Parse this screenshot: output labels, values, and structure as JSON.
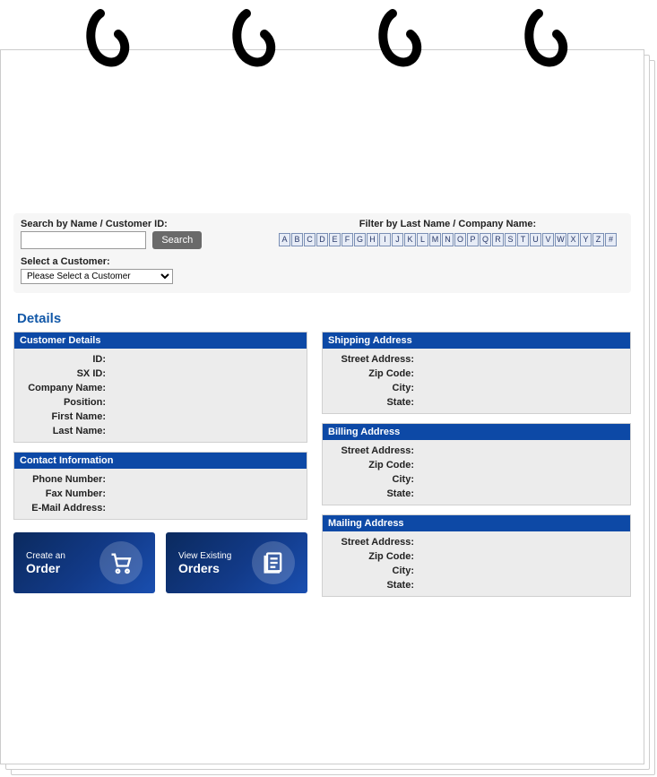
{
  "search": {
    "label": "Search by Name / Customer ID:",
    "button": "Search",
    "value": ""
  },
  "selectCustomer": {
    "label": "Select a Customer:",
    "placeholder": "Please Select a Customer"
  },
  "filter": {
    "label": "Filter by Last Name / Company Name:",
    "letters": [
      "A",
      "B",
      "C",
      "D",
      "E",
      "F",
      "G",
      "H",
      "I",
      "J",
      "K",
      "L",
      "M",
      "N",
      "O",
      "P",
      "Q",
      "R",
      "S",
      "T",
      "U",
      "V",
      "W",
      "X",
      "Y",
      "Z",
      "#"
    ]
  },
  "detailsHeading": "Details",
  "panels": {
    "customerDetails": {
      "title": "Customer Details",
      "fields": {
        "id": "ID:",
        "sxid": "SX ID:",
        "company": "Company Name:",
        "position": "Position:",
        "firstName": "First Name:",
        "lastName": "Last Name:"
      }
    },
    "contactInfo": {
      "title": "Contact Information",
      "fields": {
        "phone": "Phone Number:",
        "fax": "Fax Number:",
        "email": "E-Mail Address:"
      }
    },
    "shipping": {
      "title": "Shipping Address",
      "fields": {
        "street": "Street Address:",
        "zip": "Zip Code:",
        "city": "City:",
        "state": "State:"
      }
    },
    "billing": {
      "title": "Billing Address",
      "fields": {
        "street": "Street Address:",
        "zip": "Zip Code:",
        "city": "City:",
        "state": "State:"
      }
    },
    "mailing": {
      "title": "Mailing Address",
      "fields": {
        "street": "Street Address:",
        "zip": "Zip Code:",
        "city": "City:",
        "state": "State:"
      }
    }
  },
  "actions": {
    "createOrder": {
      "line1": "Create an",
      "line2": "Order"
    },
    "viewOrders": {
      "line1": "View Existing",
      "line2": "Orders"
    }
  }
}
